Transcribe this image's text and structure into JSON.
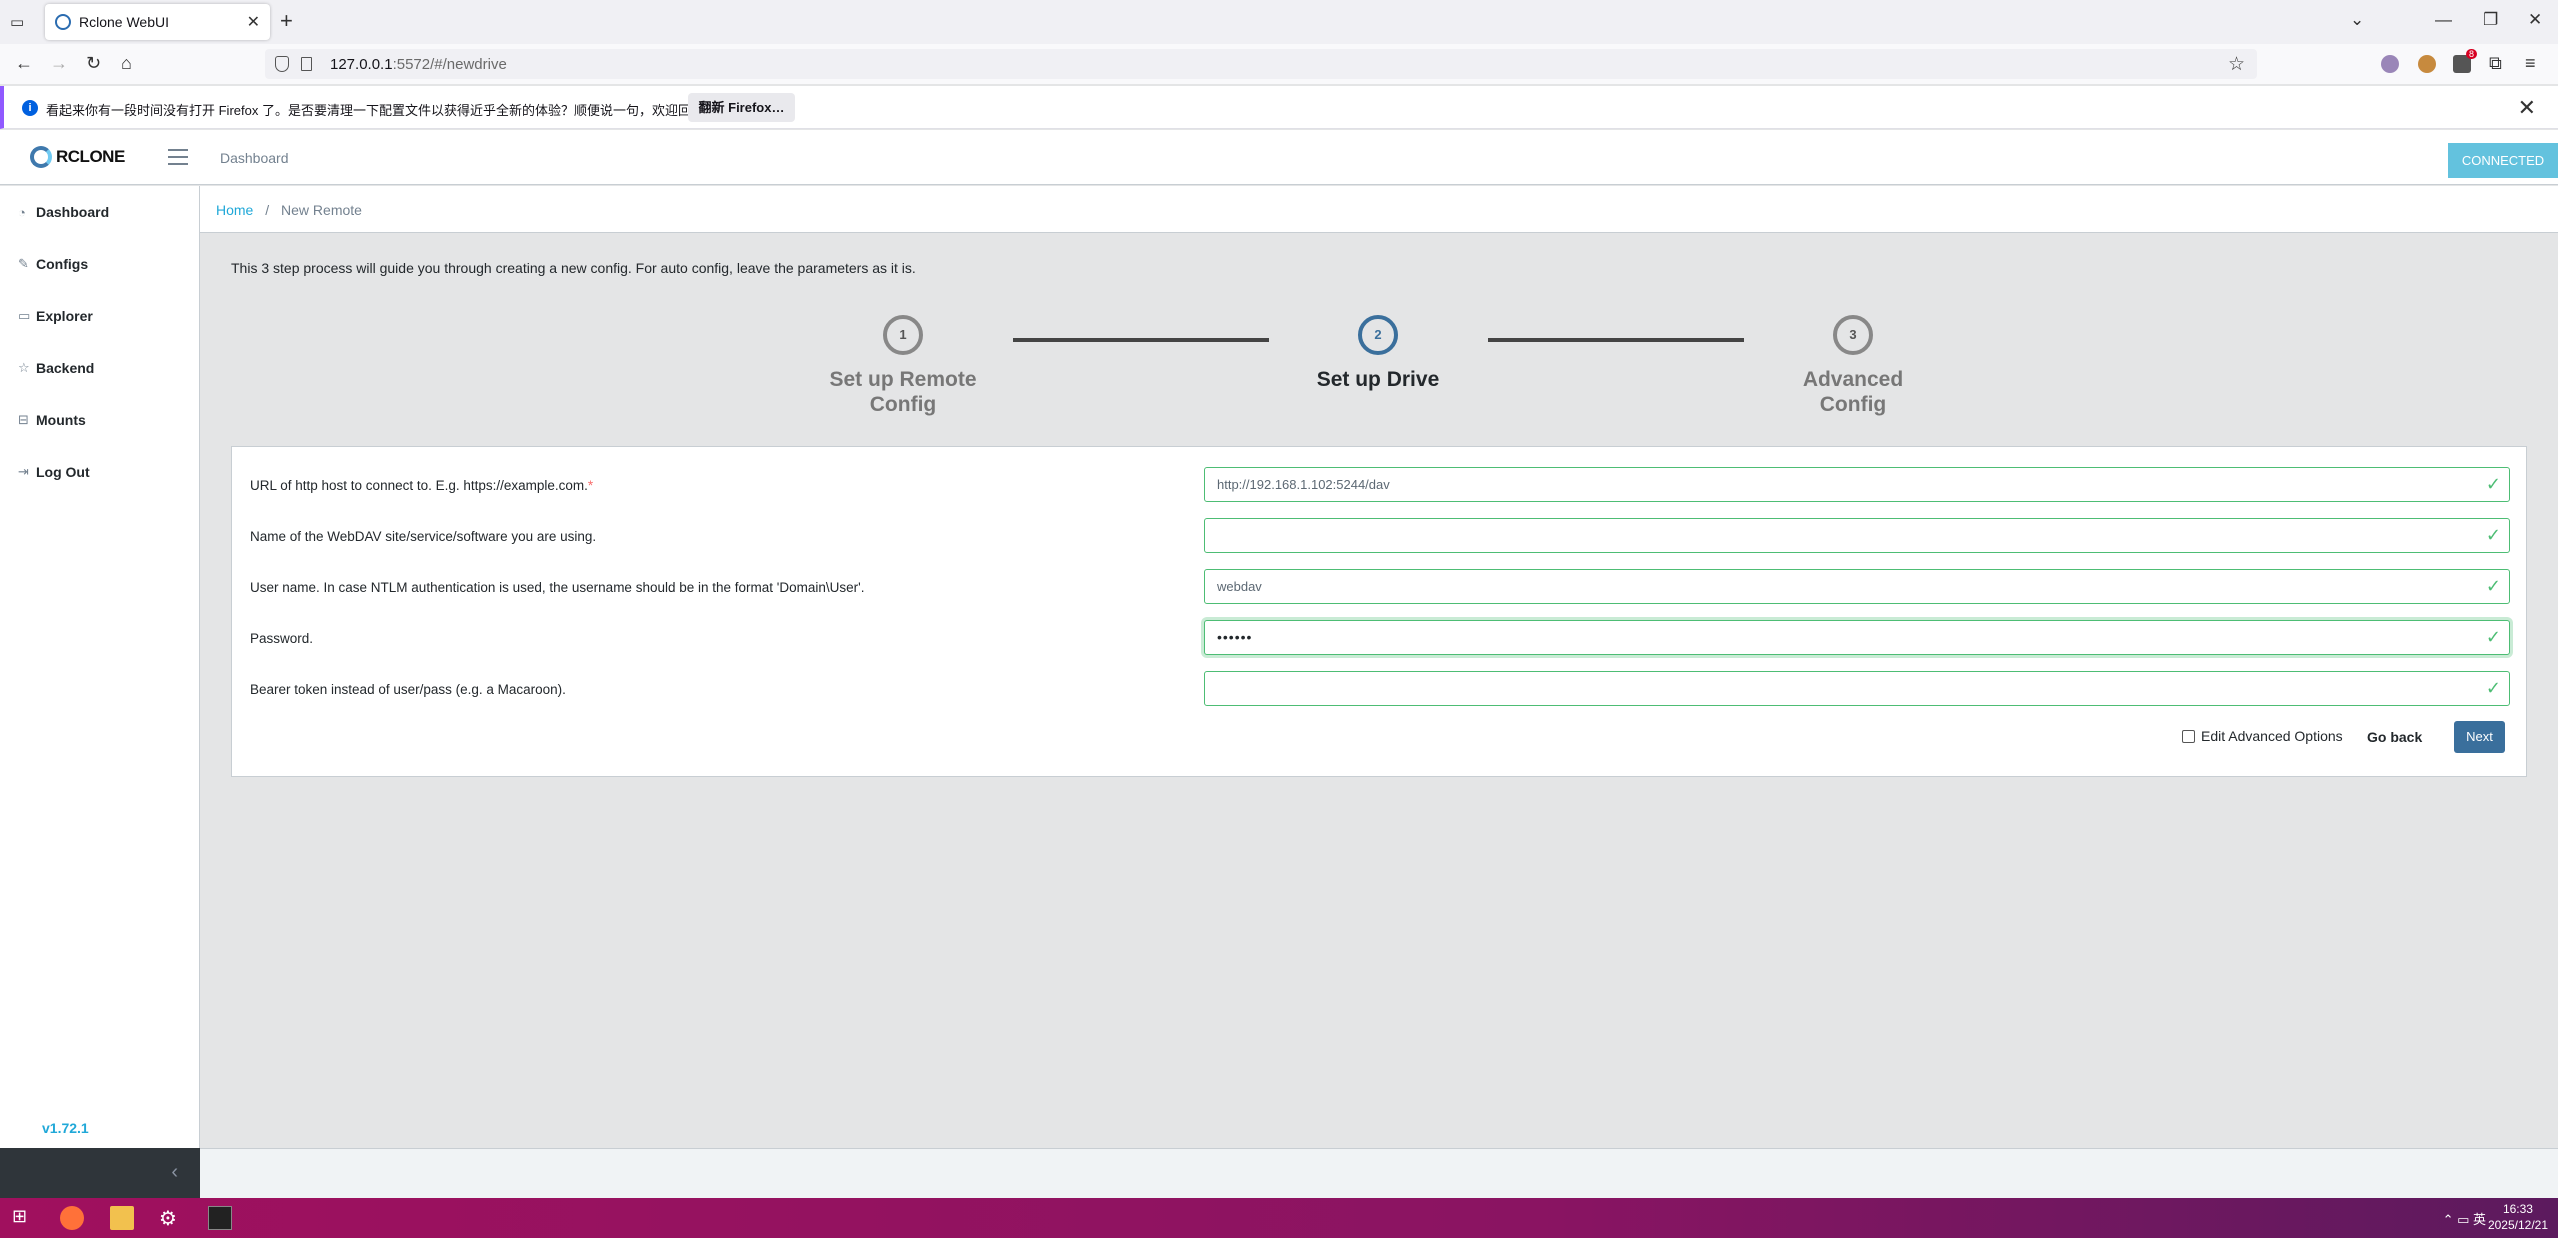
{
  "browser": {
    "tab_title": "Rclone WebUI",
    "url_host": "127.0.0.1",
    "url_rest": ":5572/#/newdrive",
    "notification_text": "看起来你有一段时间没有打开 Firefox 了。是否要清理一下配置文件以获得近乎全新的体验？顺便说一句，欢迎回来！",
    "notification_button": "翻新 Firefox…",
    "ext_badge": "8"
  },
  "header": {
    "brand": "RCLONE",
    "nav_link": "Dashboard",
    "status": "CONNECTED"
  },
  "sidebar": {
    "items": [
      {
        "label": "Dashboard",
        "icon": "speedometer-icon"
      },
      {
        "label": "Configs",
        "icon": "pencil-icon"
      },
      {
        "label": "Explorer",
        "icon": "monitor-icon"
      },
      {
        "label": "Backend",
        "icon": "star-icon"
      },
      {
        "label": "Mounts",
        "icon": "drive-icon"
      },
      {
        "label": "Log Out",
        "icon": "logout-icon"
      }
    ],
    "version": "v1.72.1"
  },
  "breadcrumb": {
    "home": "Home",
    "sep": "/",
    "current": "New Remote"
  },
  "intro": "This 3 step process will guide you through creating a new config. For auto config, leave the parameters as it is.",
  "steps": [
    {
      "number": "1",
      "label_line1": "Set up Remote",
      "label_line2": "Config"
    },
    {
      "number": "2",
      "label_line1": "Set up Drive",
      "label_line2": ""
    },
    {
      "number": "3",
      "label_line1": "Advanced",
      "label_line2": "Config"
    }
  ],
  "form": {
    "fields": [
      {
        "label": "URL of http host to connect to. E.g. https://example.com.",
        "required": "*",
        "value": "http://192.168.1.102:5244/dav"
      },
      {
        "label": "Name of the WebDAV site/service/software you are using.",
        "value": ""
      },
      {
        "label": "User name. In case NTLM authentication is used, the username should be in the format 'Domain\\User'.",
        "value": "webdav"
      },
      {
        "label": "Password.",
        "value": "••••••"
      },
      {
        "label": "Bearer token instead of user/pass (e.g. a Macaroon).",
        "value": ""
      }
    ],
    "advanced_label": "Edit Advanced Options",
    "back_label": "Go back",
    "next_label": "Next"
  },
  "taskbar": {
    "time": "16:33",
    "date": "2025/12/21",
    "ime": "英"
  },
  "colors": {
    "accent": "#3a6f9c",
    "valid": "#4dbd74",
    "connected": "#63c2de",
    "link": "#20a8d8"
  }
}
